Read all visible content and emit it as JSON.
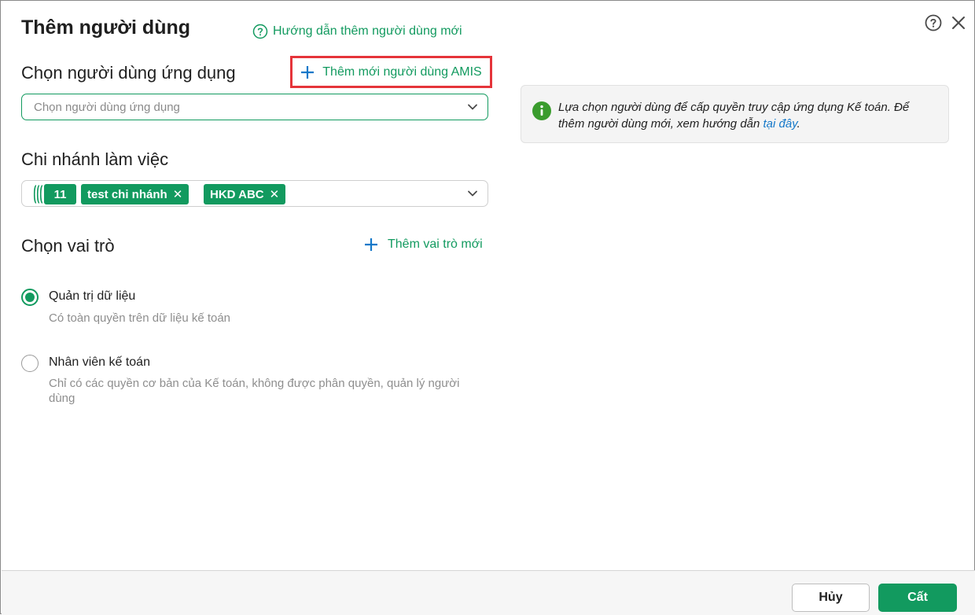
{
  "dialog": {
    "title": "Thêm người dùng",
    "guide_link": "Hướng dẫn thêm người dùng mới"
  },
  "user_section": {
    "label": "Chọn người dùng ứng dụng",
    "add_amis_label": "Thêm mới người dùng AMIS",
    "select_placeholder": "Chọn người dùng ứng dụng"
  },
  "branch_section": {
    "label": "Chi nhánh làm việc",
    "count_badge": "11",
    "chips": [
      "test chi nhánh",
      "HKD ABC"
    ]
  },
  "role_section": {
    "label": "Chọn vai trò",
    "add_role_label": "Thêm vai trò mới",
    "roles": [
      {
        "name": "Quản trị dữ liệu",
        "description": "Có toàn quyền trên dữ liệu kế toán",
        "selected": true
      },
      {
        "name": "Nhân viên kế toán",
        "description": "Chỉ có các quyền cơ bản của Kế toán, không được phân quyền, quản lý người dùng",
        "selected": false
      }
    ]
  },
  "info_box": {
    "text": "Lựa chọn người dùng để cấp quyền truy cập ứng dụng Kế toán. Để thêm người dùng mới, xem hướng dẫn ",
    "link_text": "tại đây",
    "suffix": "."
  },
  "footer": {
    "cancel_label": "Hủy",
    "save_label": "Cất"
  },
  "colors": {
    "accent": "#129a5f",
    "highlight_border": "#e5343a",
    "link": "#1478c9"
  },
  "icons": [
    "help-icon",
    "close-icon",
    "plus-icon",
    "chevron-down-icon",
    "info-icon",
    "remove-chip-icon"
  ]
}
